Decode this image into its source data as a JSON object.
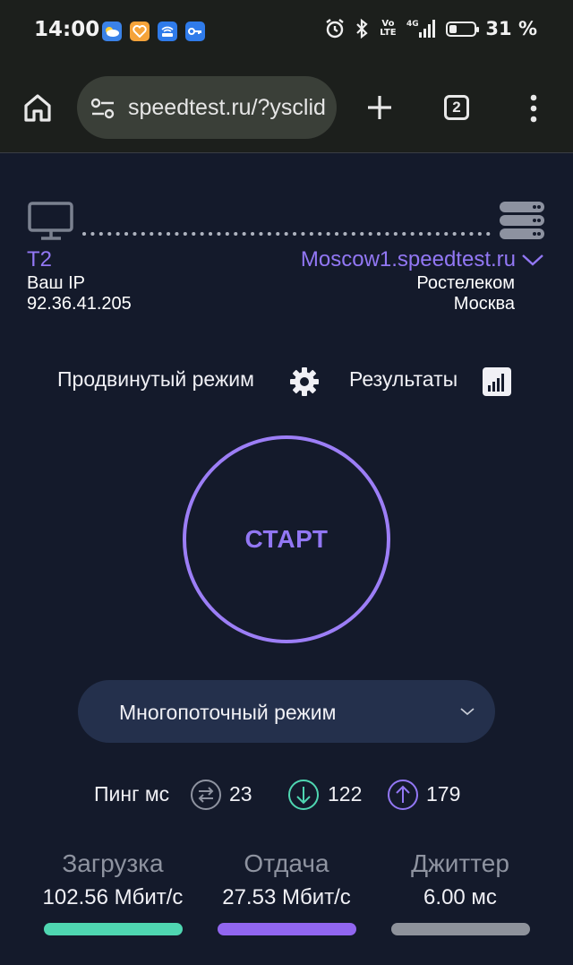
{
  "statusbar": {
    "time": "14:00",
    "battery": "31 %",
    "battery_level": 0.31,
    "app_icons": [
      {
        "name": "weather-icon",
        "color": "#3a82e8"
      },
      {
        "name": "heart-app-icon",
        "color": "#f5a33a"
      },
      {
        "name": "router-app-icon",
        "color": "#2f7bea"
      },
      {
        "name": "key-app-icon",
        "color": "#2f7bea"
      }
    ],
    "network": "4G",
    "volte": "Vo LTE"
  },
  "browser": {
    "url": "speedtest.ru/?ysclid",
    "tab_count": "2"
  },
  "connection": {
    "provider": "T2",
    "ip_label": "Ваш IP",
    "ip": "92.36.41.205",
    "server": "Moscow1.speedtest.ru",
    "server_isp": "Ростелеком",
    "server_city": "Москва"
  },
  "toolbar": {
    "advanced_mode": "Продвинутый режим",
    "results": "Результаты"
  },
  "start_label": "СТАРТ",
  "mode_select": {
    "value": "Многопоточный режим"
  },
  "ping": {
    "label": "Пинг мс",
    "idle": "23",
    "download": "122",
    "upload": "179"
  },
  "metrics": [
    {
      "title": "Загрузка",
      "value": "102.56 Мбит/с",
      "color": "#4fd6b1"
    },
    {
      "title": "Отдача",
      "value": "27.53 Мбит/с",
      "color": "#9166f0"
    },
    {
      "title": "Джиттер",
      "value": "6.00 мс",
      "color": "#8e929b"
    }
  ],
  "colors": {
    "accent": "#9277f4",
    "background": "#141a2b",
    "select_bg": "#24304c"
  }
}
